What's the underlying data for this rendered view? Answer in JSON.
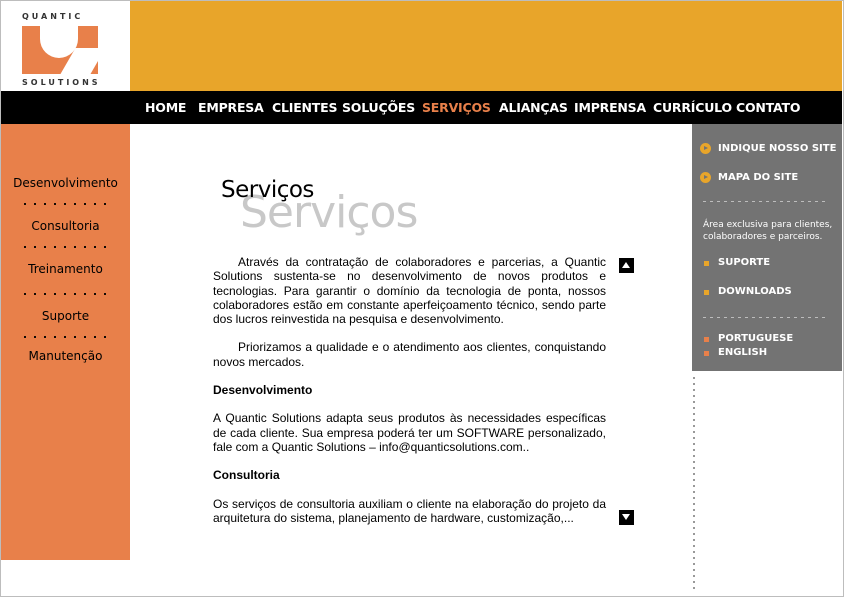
{
  "logo": {
    "top_text": "QUANTIC",
    "bottom_text": "SOLUTIONS"
  },
  "nav": {
    "items": [
      {
        "label": "HOME",
        "active": false
      },
      {
        "label": "EMPRESA",
        "active": false
      },
      {
        "label": "CLIENTES",
        "active": false
      },
      {
        "label": "SOLUÇÕES",
        "active": false
      },
      {
        "label": "SERVIÇOS",
        "active": true
      },
      {
        "label": "ALIANÇAS",
        "active": false
      },
      {
        "label": "IMPRENSA",
        "active": false
      },
      {
        "label": "CURRÍCULO",
        "active": false
      },
      {
        "label": "CONTATO",
        "active": false
      }
    ]
  },
  "left_menu": {
    "items": [
      "Desenvolvimento",
      "Consultoria",
      "Treinamento",
      "Suporte",
      "Manutenção"
    ]
  },
  "right_menu": {
    "indique": "INDIQUE NOSSO SITE",
    "mapa": "MAPA DO SITE",
    "area_text": "Área exclusiva para clientes, colaboradores e parceiros.",
    "suporte": "SUPORTE",
    "downloads": "DOWNLOADS",
    "portuguese": "PORTUGUESE",
    "english": "ENGLISH"
  },
  "main": {
    "title_small": "Serviços",
    "title_big": "Serviços",
    "p1": "Através da contratação de colaboradores e parcerias, a Quantic Solutions sustenta-se no desenvolvimento de novos produtos e tecnologias. Para garantir o domínio da tecnologia de ponta, nossos colaboradores estão em constante aperfeiçoamento técnico, sendo parte dos lucros reinvestida na pesquisa e desenvolvimento.",
    "p2": "Priorizamos a qualidade e o atendimento aos clientes, conquistando novos mercados.",
    "h1": "Desenvolvimento",
    "p3": "A Quantic Solutions adapta seus produtos às necessidades específicas de cada cliente. Sua empresa poderá ter um SOFTWARE personalizado, fale com a Quantic Solutions – info@quanticsolutions.com..",
    "h2": "Consultoria",
    "p4": "Os serviços de consultoria auxiliam o cliente na elaboração do projeto da arquitetura do sistema, planejamento de hardware, customização,..."
  },
  "colors": {
    "orange": "#e8804a",
    "yellow": "#e8a52a",
    "gray": "#737373",
    "black": "#000000"
  }
}
